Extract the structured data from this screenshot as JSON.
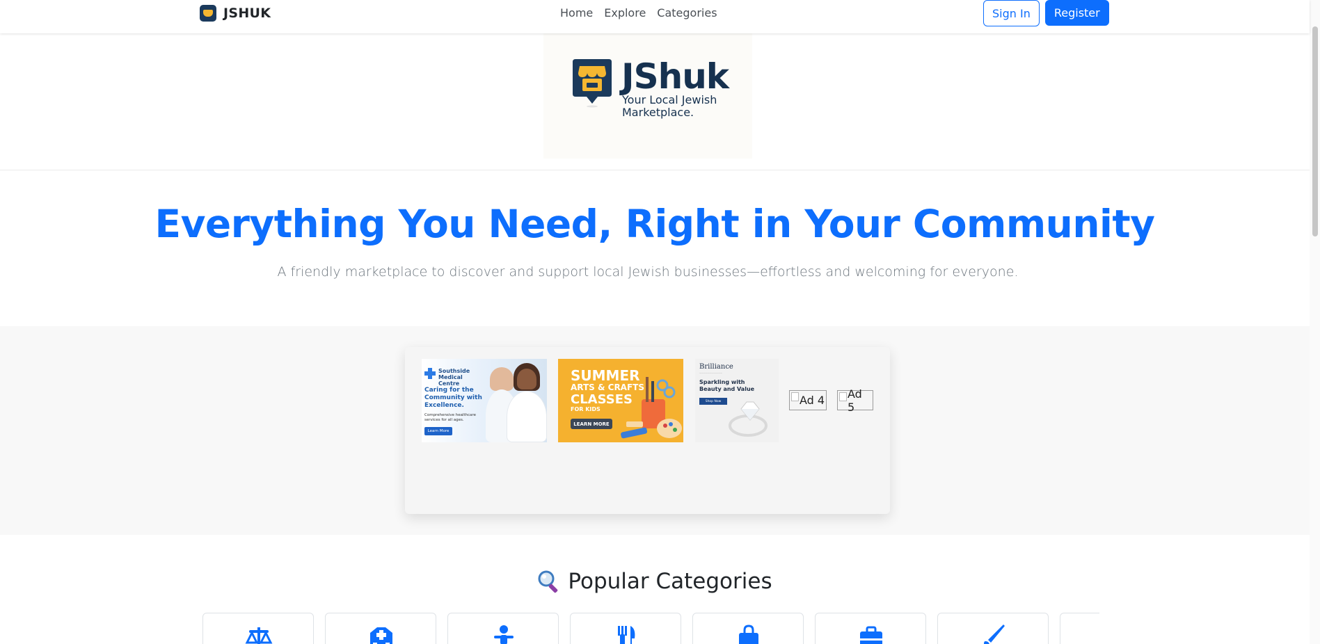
{
  "navbar": {
    "brand": "JSHUK",
    "brand_icon": "store-logo-icon",
    "links": [
      {
        "label": "Home"
      },
      {
        "label": "Explore"
      },
      {
        "label": "Categories"
      }
    ],
    "sign_in_label": "Sign In",
    "register_label": "Register"
  },
  "logo_banner": {
    "wordmark": "JShuk",
    "tagline": "Your Local Jewish Marketplace."
  },
  "hero": {
    "title": "Everything You Need, Right in Your Community",
    "subtitle": "A friendly marketplace to discover and support local Jewish businesses—effortless and welcoming for everyone."
  },
  "ads": {
    "ad1": {
      "brand": "Southside Medical Centre",
      "headline": "Caring for the Community with Excellence.",
      "body": "Comprehensive healthcare services for all ages.",
      "button": "Learn More"
    },
    "ad2": {
      "line1": "SUMMER",
      "line2": "ARTS & CRAFTS",
      "line3": "CLASSES",
      "line4": "FOR KIDS",
      "button": "LEARN MORE"
    },
    "ad3": {
      "brand": "Brilliance",
      "headline": "Sparkling with Beauty and Value",
      "button": "Shop Now"
    },
    "ad4_alt": "Ad 4",
    "ad5_alt": "Ad 5"
  },
  "categories": {
    "title": "Popular Categories",
    "title_icon": "magnifier-icon",
    "cards": [
      {
        "icon": "scale-icon"
      },
      {
        "icon": "hospital-icon"
      },
      {
        "icon": "child-icon"
      },
      {
        "icon": "utensils-icon"
      },
      {
        "icon": "shopping-bag-icon"
      },
      {
        "icon": "briefcase-icon"
      },
      {
        "icon": "paintbrush-icon"
      },
      {
        "icon": "partial-card"
      }
    ]
  },
  "colors": {
    "primary": "#0d6efd",
    "brand_navy": "#16314f",
    "brand_yellow": "#f5b731"
  }
}
